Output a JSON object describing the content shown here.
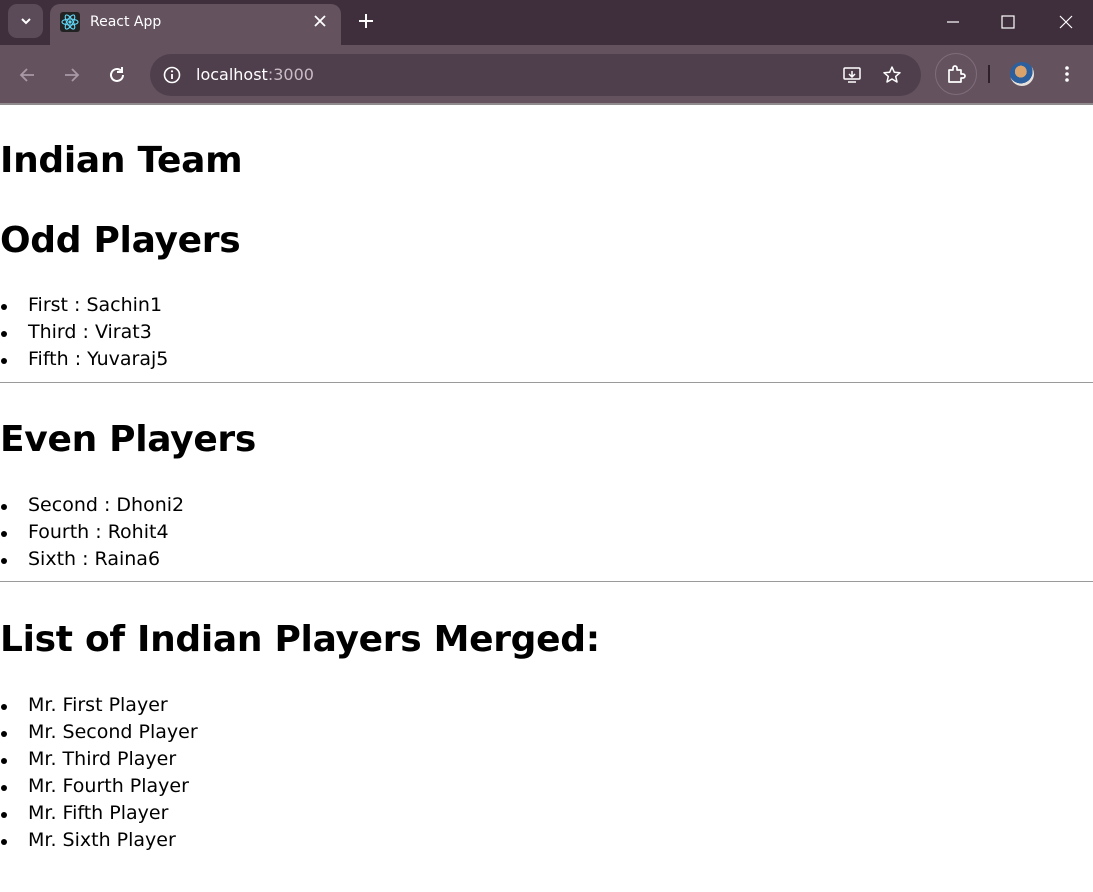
{
  "browser": {
    "tab_title": "React App",
    "url_host": "localhost",
    "url_port": ":3000"
  },
  "page": {
    "title": "Indian Team",
    "odd_heading": "Odd Players",
    "odd_players": [
      "First : Sachin1",
      "Third : Virat3",
      "Fifth : Yuvaraj5"
    ],
    "even_heading": "Even Players",
    "even_players": [
      "Second : Dhoni2",
      "Fourth : Rohit4",
      "Sixth : Raina6"
    ],
    "merged_heading": "List of Indian Players Merged:",
    "merged_players": [
      "Mr. First Player",
      "Mr. Second Player",
      "Mr. Third Player",
      "Mr. Fourth Player",
      "Mr. Fifth Player",
      "Mr. Sixth Player"
    ]
  },
  "icons": [
    "tab-search-icon",
    "react-favicon-icon",
    "close-icon",
    "plus-icon",
    "minimize-icon",
    "maximize-icon",
    "window-close-icon",
    "back-icon",
    "forward-icon",
    "reload-icon",
    "info-icon",
    "install-app-icon",
    "star-icon",
    "extensions-icon",
    "avatar",
    "menu-icon"
  ],
  "colors": {
    "chrome_dark": "#3f2e3c",
    "chrome_toolbar": "#64525f",
    "omnibox": "#4f3f4c"
  }
}
